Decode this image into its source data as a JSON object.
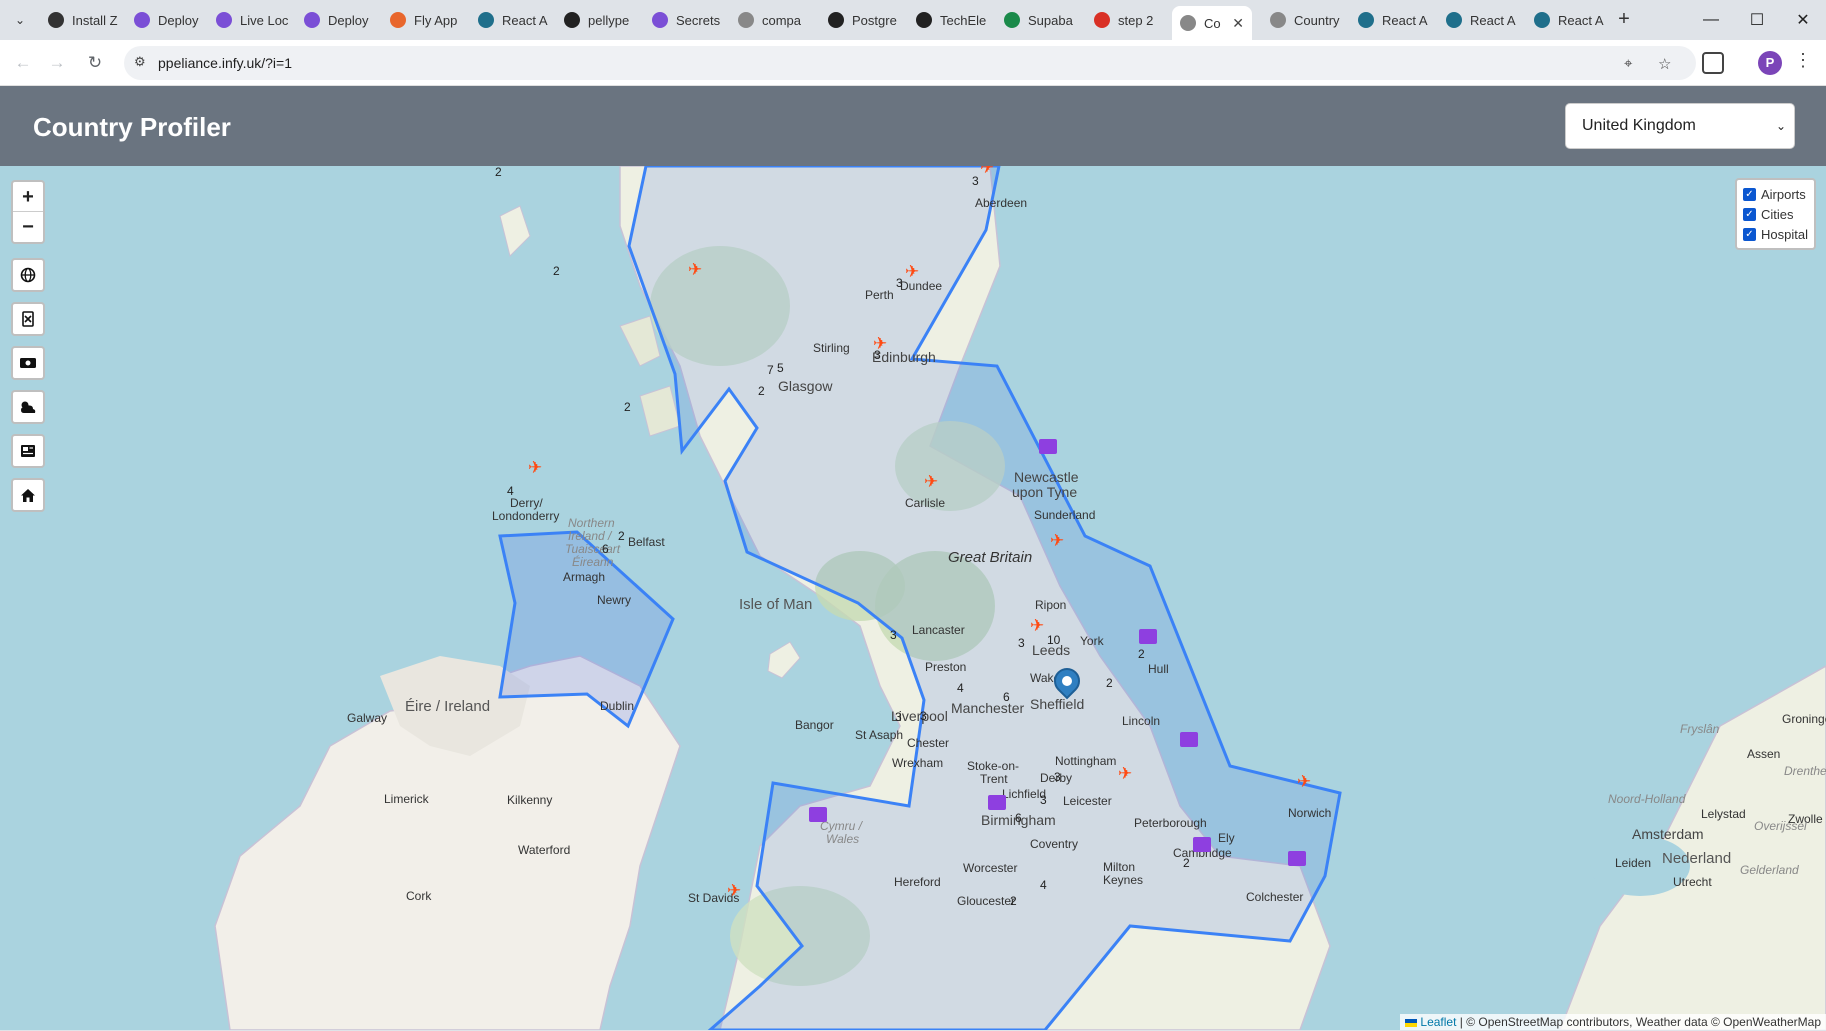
{
  "browser": {
    "tabs": [
      {
        "label": "Install Z",
        "color": "#333"
      },
      {
        "label": "Deploy",
        "color": "#7b4fd6"
      },
      {
        "label": "Live Loc",
        "color": "#7b4fd6"
      },
      {
        "label": "Deploy",
        "color": "#7b4fd6"
      },
      {
        "label": "Fly App",
        "color": "#e8662c"
      },
      {
        "label": "React A",
        "color": "#1f6f8b"
      },
      {
        "label": "pellype",
        "color": "#222"
      },
      {
        "label": "Secrets",
        "color": "#7b4fd6"
      },
      {
        "label": "compa",
        "color": "#888"
      },
      {
        "label": "Postgre",
        "color": "#222"
      },
      {
        "label": "TechEle",
        "color": "#222"
      },
      {
        "label": "Supaba",
        "color": "#1a8a4a"
      },
      {
        "label": "step 2",
        "color": "#d93025"
      },
      {
        "label": "Co",
        "color": "#888"
      },
      {
        "label": "Country",
        "color": "#888"
      },
      {
        "label": "React A",
        "color": "#1f6f8b"
      },
      {
        "label": "React A",
        "color": "#1f6f8b"
      },
      {
        "label": "React A",
        "color": "#1f6f8b"
      }
    ],
    "url": "ppeliance.infy.uk/?i=1",
    "profile_initial": "P"
  },
  "app": {
    "title": "Country Profiler",
    "country_select": {
      "value": "United Kingdom"
    }
  },
  "map": {
    "controls": {
      "zoom_in": "+",
      "zoom_out": "−"
    },
    "layers": [
      {
        "label": "Airports",
        "checked": true
      },
      {
        "label": "Cities",
        "checked": true
      },
      {
        "label": "Hospital",
        "checked": true
      }
    ],
    "attribution": {
      "leaflet": "Leaflet",
      "rest": "| © OpenStreetMap contributors, Weather data © OpenWeatherMap"
    },
    "labels": {
      "aberdeen": "Aberdeen",
      "dundee": "Dundee",
      "perth": "Perth",
      "stirling": "Stirling",
      "edinburgh": "Edinburgh",
      "glasgow": "Glasgow",
      "newcastle1": "Newcastle",
      "newcastle2": "upon Tyne",
      "carlisle": "Carlisle",
      "sunderland": "Sunderland",
      "great_britain": "Great Britain",
      "derry1": "Derry/",
      "derry2": "Londonderry",
      "ni1": "Northern",
      "ni2": "Ireland /",
      "ni3": "Tuaisceart",
      "ni4": "Éireann",
      "belfast": "Belfast",
      "armagh": "Armagh",
      "newry": "Newry",
      "isle_of_man": "Isle of Man",
      "ripon": "Ripon",
      "lancaster": "Lancaster",
      "york": "York",
      "leeds": "Leeds",
      "preston": "Preston",
      "wakefield": "Wake",
      "hull": "Hull",
      "manchester": "Manchester",
      "sheffield": "Sheffield",
      "liverpool": "Liverpool",
      "bangor": "Bangor",
      "st_asaph": "St Asaph",
      "chester": "Chester",
      "wrexham": "Wrexham",
      "lincoln": "Lincoln",
      "stoke1": "Stoke-on-",
      "stoke2": "Trent",
      "nottingham": "Nottingham",
      "derby": "Derby",
      "lichfield": "Lichfield",
      "leicester": "Leicester",
      "birmingham": "Birmingham",
      "peterborough": "Peterborough",
      "norwich": "Norwich",
      "coventry": "Coventry",
      "ely": "Ely",
      "cambridge": "Cambridge",
      "cymru1": "Cymru /",
      "cymru2": "Wales",
      "worcester": "Worcester",
      "milton1": "Milton",
      "milton2": "Keynes",
      "hereford": "Hereford",
      "st_davids": "St Davids",
      "gloucester": "Gloucester",
      "colchester": "Colchester",
      "galway": "Galway",
      "eire": "Éire / Ireland",
      "dublin": "Dublin",
      "limerick": "Limerick",
      "kilkenny": "Kilkenny",
      "waterford": "Waterford",
      "cork": "Cork",
      "amsterdam": "Amsterdam",
      "nederland": "Nederland",
      "utrecht": "Utrecht",
      "leiden": "Leiden",
      "lelystad": "Lelystad",
      "assen": "Assen",
      "drenthe": "Drenthe",
      "groningen": "Groninge",
      "fryslan": "Fryslân",
      "noord_holland": "Noord-Holland",
      "overijssel": "Overijssel",
      "gelderland": "Gelderland",
      "zwolle": "Zwolle"
    },
    "cluster_counts": {
      "c1": "2",
      "c2": "3",
      "c3": "2",
      "c4": "3",
      "c5": "3",
      "c6": "7",
      "c7": "5",
      "c8": "2",
      "c9": "2",
      "c10": "4",
      "c11": "2",
      "c12": "6",
      "c13": "3",
      "c14": "3",
      "c15": "10",
      "c16": "2",
      "c17": "4",
      "c18": "6",
      "c19": "2",
      "c20": "3",
      "c21": "3",
      "c22": "3",
      "c23": "3",
      "c24": "6",
      "c25": "2",
      "c26": "2",
      "c27": "4"
    }
  }
}
